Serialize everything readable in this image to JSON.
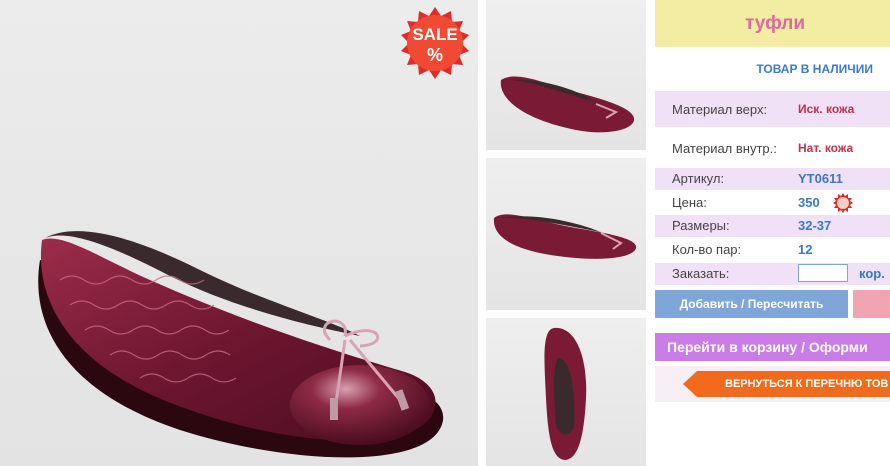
{
  "product": {
    "title": "туфли",
    "stock_status": "ТОВАР В НАЛИЧИИ",
    "sale_label": "SALE",
    "sale_percent": "%"
  },
  "specs": [
    {
      "label": "Материал верх:",
      "value": "Иск. кожа"
    },
    {
      "label": "Материал внутр.:",
      "value": "Нат. кожа"
    },
    {
      "label": "Артикул:",
      "value": "YT0611"
    },
    {
      "label": "Цена:",
      "value": "350"
    },
    {
      "label": "Размеры:",
      "value": "32-37"
    },
    {
      "label": "Кол-во пар:",
      "value": "12"
    },
    {
      "label": "Заказать:",
      "unit": "кор."
    }
  ],
  "actions": {
    "add_label": "Добавить / Пересчитать",
    "cart_label": "Перейти в корзину / Оформи",
    "back_label": "ВЕРНУТЬСЯ К ПЕРЕЧНЮ ТОВ"
  },
  "colors": {
    "shoe": "#7a1a34",
    "accent_red": "#e02b2b",
    "title_bg": "#f3eca3",
    "title_fg": "#e068a0"
  },
  "icons": [
    "sale-badge-icon",
    "small-sale-icon",
    "back-arrow-icon"
  ]
}
